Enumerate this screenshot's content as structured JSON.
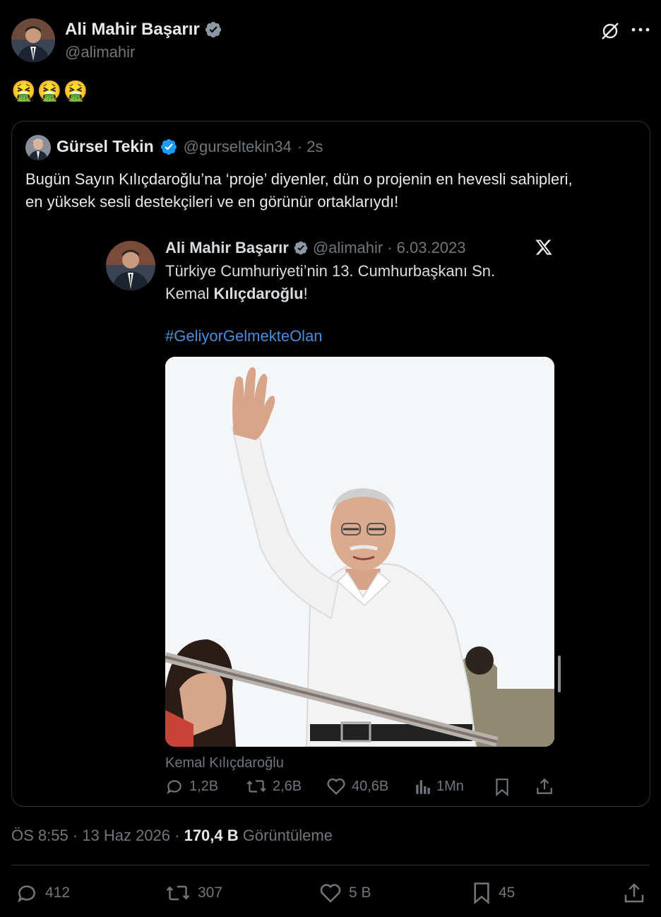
{
  "post": {
    "author_name": "Ali Mahir Başarır",
    "author_handle": "@alimahir",
    "body_emojis": "🤮🤮🤮",
    "timestamp": "ÖS 8:55 · 13 Haz 2026 · ",
    "views_count": "170,4 B",
    "views_label": " Görüntüleme",
    "actions": {
      "replies": "412",
      "reposts": "307",
      "likes": "5 B",
      "bookmarks": "45"
    }
  },
  "quote": {
    "author_name": "Gürsel Tekin",
    "author_handle": "@gurseltekin34",
    "time": "· 2s",
    "text_line1": "Bugün Sayın Kılıçdaroğlu’na ‘proje’ diyenler, dün o projenin en hevesli sahipleri,",
    "text_line2": "en yüksek sesli destekçileri ve en görünür ortaklarıydı!"
  },
  "embedded": {
    "author_name": "Ali Mahir Başarır",
    "author_handle": "@alimahir",
    "date": "· 6.03.2023",
    "line1": "Türkiye Cumhuriyeti’nin 13. Cumhurbaşkanı Sn.",
    "line2_prefix": "Kemal ",
    "line2_bold": "Kılıçdaroğlu",
    "line2_suffix": "!",
    "hashtag": "#GeliyorGelmekteOlan",
    "caption": "Kemal Kılıçdaroğlu",
    "actions": {
      "replies": "1,2B",
      "reposts": "2,6B",
      "likes": "40,6B",
      "views": "1Mn"
    }
  },
  "icons": {
    "grok": "grok-icon",
    "more": "more-icon",
    "verified": "verified-badge-icon",
    "x_logo": "x-logo-icon"
  },
  "colors": {
    "background": "#000000",
    "text": "#e7e9ea",
    "muted": "#71767b",
    "verified": "#1d9bf0",
    "hashtag": "#4c8cd8",
    "border": "#2f3336"
  }
}
